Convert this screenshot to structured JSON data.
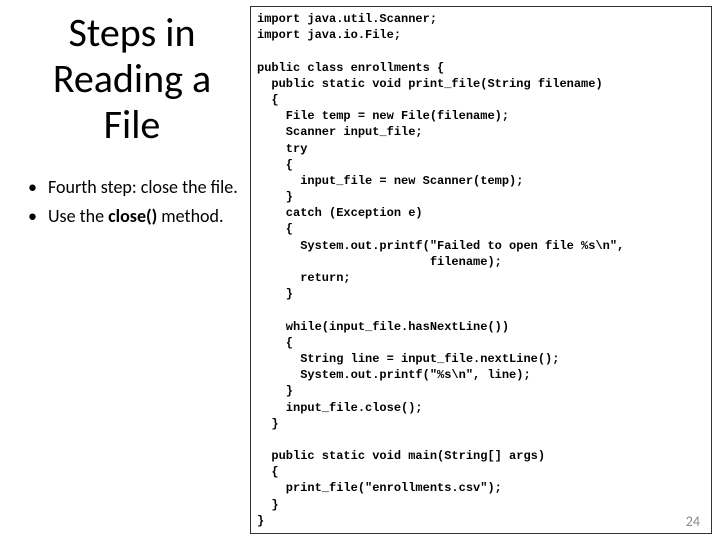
{
  "title_line1": "Steps in",
  "title_line2": "Reading a",
  "title_line3": "File",
  "bullets": [
    {
      "pre": "Fourth step: close the file."
    },
    {
      "pre": "Use the ",
      "bold": "close()",
      "post": " method."
    }
  ],
  "code": "import java.util.Scanner;\nimport java.io.File;\n\npublic class enrollments {\n  public static void print_file(String filename)\n  {\n    File temp = new File(filename);\n    Scanner input_file;\n    try\n    {\n      input_file = new Scanner(temp);\n    }\n    catch (Exception e)\n    {\n      System.out.printf(\"Failed to open file %s\\n\",\n                        filename);\n      return;\n    }\n\n    while(input_file.hasNextLine())\n    {\n      String line = input_file.nextLine();\n      System.out.printf(\"%s\\n\", line);\n    }\n    input_file.close();\n  }\n\n  public static void main(String[] args)\n  {\n    print_file(\"enrollments.csv\");\n  }\n}",
  "page_number": "24"
}
